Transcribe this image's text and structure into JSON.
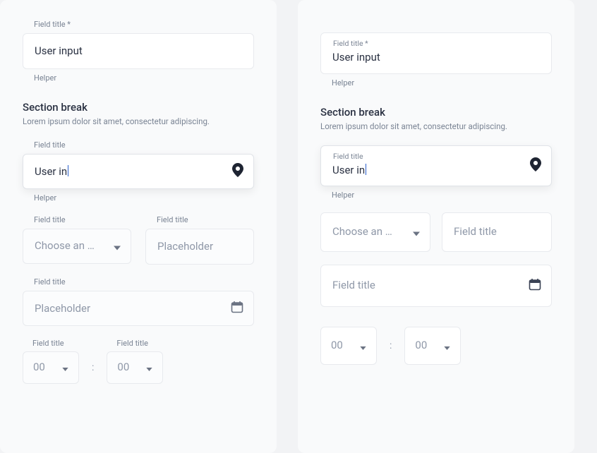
{
  "left": {
    "field1": {
      "label": "Field title *",
      "value": "User input",
      "helper": "Helper"
    },
    "section": {
      "title": "Section break",
      "desc": "Lorem ipsum dolor sit amet, consectetur adipiscing."
    },
    "field2": {
      "label": "Field title",
      "value": "User in",
      "helper": "Helper"
    },
    "select": {
      "label": "Field title",
      "placeholder": "Choose an option"
    },
    "field3": {
      "label": "Field title",
      "placeholder": "Placeholder"
    },
    "date": {
      "label": "Field title",
      "placeholder": "Placeholder"
    },
    "time1": {
      "label": "Field title",
      "value": "00"
    },
    "time2": {
      "label": "Field title",
      "value": "00"
    },
    "time_sep": ":"
  },
  "right": {
    "field1": {
      "label": "Field title *",
      "value": "User input",
      "helper": "Helper"
    },
    "section": {
      "title": "Section break",
      "desc": "Lorem ipsum dolor sit amet, consectetur adipiscing."
    },
    "field2": {
      "label": "Field title",
      "value": "User in",
      "helper": "Helper"
    },
    "select": {
      "placeholder": "Choose an option"
    },
    "field3": {
      "placeholder": "Field title"
    },
    "date": {
      "placeholder": "Field title"
    },
    "time1": {
      "value": "00"
    },
    "time2": {
      "value": "00"
    },
    "time_sep": ":"
  }
}
